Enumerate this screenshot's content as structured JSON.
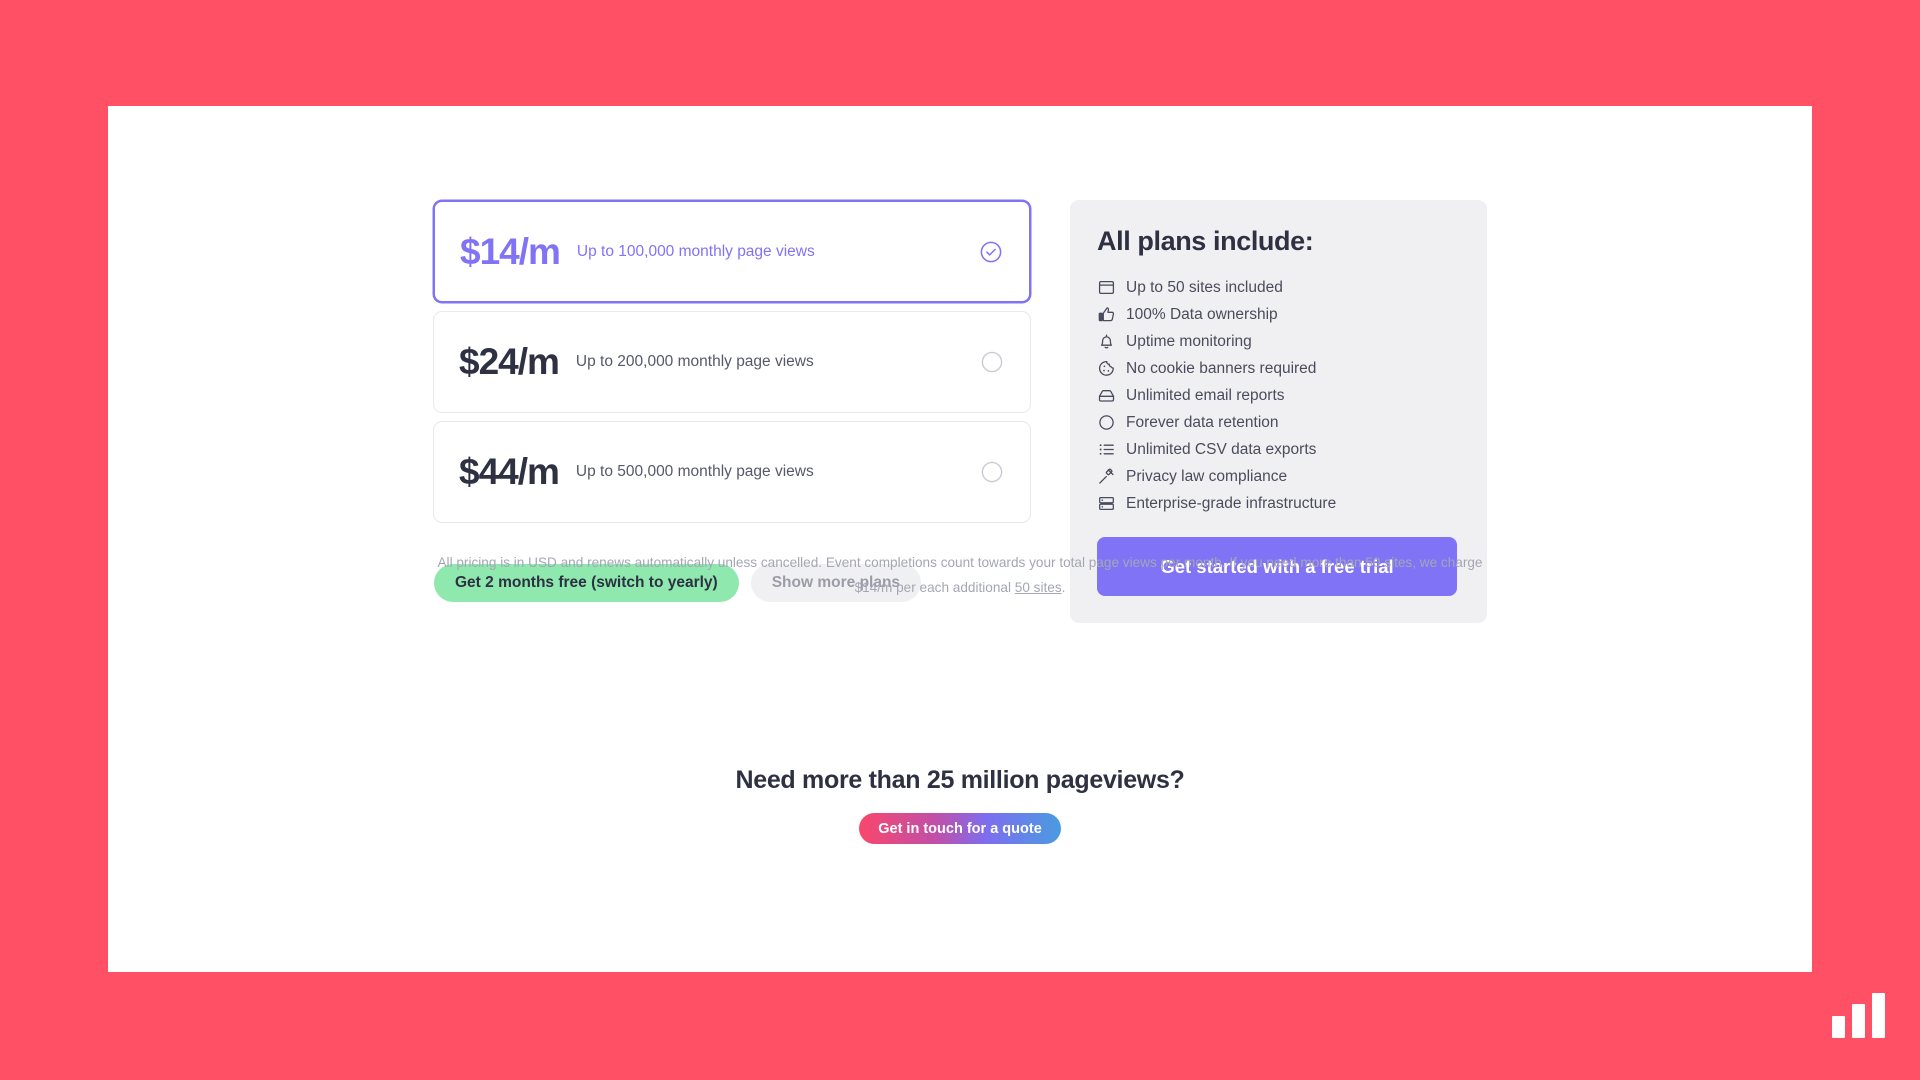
{
  "theme": {
    "background_color": "#ff5066",
    "accent_color": "#8173f5",
    "green_pill_color": "#8fe8ae",
    "panel_color": "#f0f0f2",
    "text_color": "#2d3142"
  },
  "plans": [
    {
      "price": "$14/m",
      "description": "Up to 100,000 monthly page views",
      "selected": true,
      "radio_icon": "check-circle-icon"
    },
    {
      "price": "$24/m",
      "description": "Up to 200,000 monthly page views",
      "selected": false,
      "radio_icon": "circle-icon"
    },
    {
      "price": "$44/m",
      "description": "Up to 500,000 monthly page views",
      "selected": false,
      "radio_icon": "circle-icon"
    }
  ],
  "pills": {
    "yearly_label": "Get 2 months free (switch to yearly)",
    "more_plans_label": "Show more plans"
  },
  "fineprint": {
    "line1": "All pricing is in USD and renews automatically unless cancelled. Event completions count towards your total page views per month. If you need more than",
    "line2_before": "50 sites, we charge $14/m per each additional ",
    "link_text": "50 sites",
    "line2_after": "."
  },
  "includes": {
    "title": "All plans include:",
    "features": [
      {
        "icon": "browser-window-icon",
        "label": "Up to 50 sites included"
      },
      {
        "icon": "thumbs-up-icon",
        "label": "100% Data ownership"
      },
      {
        "icon": "bell-icon",
        "label": "Uptime monitoring"
      },
      {
        "icon": "cookie-icon",
        "label": "No cookie banners required"
      },
      {
        "icon": "inbox-icon",
        "label": "Unlimited email reports"
      },
      {
        "icon": "circle-icon",
        "label": "Forever data retention"
      },
      {
        "icon": "list-icon",
        "label": "Unlimited CSV data exports"
      },
      {
        "icon": "gavel-icon",
        "label": "Privacy law compliance"
      },
      {
        "icon": "server-icon",
        "label": "Enterprise-grade infrastructure"
      }
    ],
    "cta_label": "Get started with a free trial"
  },
  "enterprise": {
    "title": "Need more than 25 million pageviews?",
    "button_label": "Get in touch for a quote"
  },
  "logo": {
    "name": "bar-chart-logo"
  }
}
